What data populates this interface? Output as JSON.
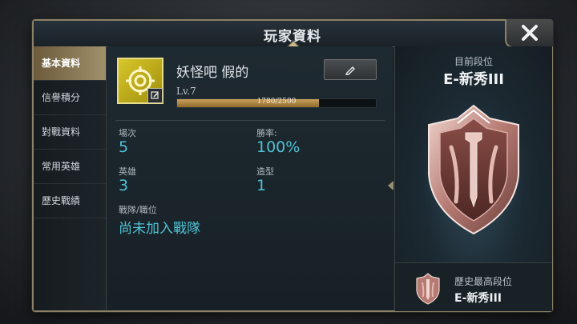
{
  "window": {
    "title": "玩家資料"
  },
  "sidebar": {
    "items": [
      {
        "label": "基本資料",
        "active": true
      },
      {
        "label": "信譽積分",
        "active": false
      },
      {
        "label": "對戰資料",
        "active": false
      },
      {
        "label": "常用英雄",
        "active": false
      },
      {
        "label": "歷史戰績",
        "active": false
      }
    ]
  },
  "profile": {
    "name": "妖怪吧 假的",
    "level_label": "Lv.7",
    "xp_text": "1780/2500",
    "xp_current": 1780,
    "xp_max": 2500,
    "stats": {
      "matches_label": "場次",
      "matches_value": "5",
      "winrate_label": "勝率:",
      "winrate_value": "100%",
      "heroes_label": "英雄",
      "heroes_value": "3",
      "skins_label": "造型",
      "skins_value": "1",
      "team_label": "戰隊/職位",
      "team_value": "尚未加入戰隊"
    }
  },
  "rank": {
    "current_title": "目前段位",
    "current_name": "E-新秀III",
    "highest_title": "歷史最高段位",
    "highest_name": "E-新秀III"
  },
  "colors": {
    "accent_value": "#4ec2d4",
    "sidebar_active": "#a0906a",
    "frame_gold": "#8c8066",
    "avatar_yellow": "#d8c62a",
    "xp_fill": "#c9a15c"
  },
  "icons": {
    "close": "close-icon",
    "edit": "pencil-icon",
    "avatar": "target-crosshair-icon",
    "rank": "shield-emblem-icon"
  }
}
